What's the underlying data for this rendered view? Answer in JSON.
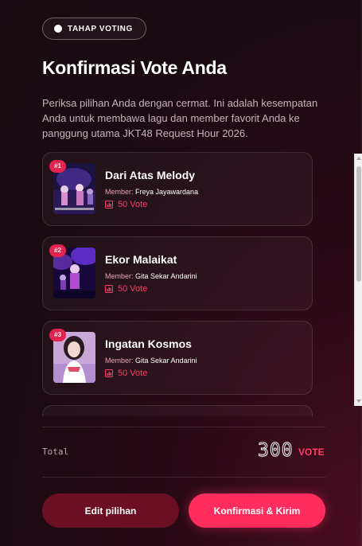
{
  "stage": {
    "label": "TAHAP VOTING"
  },
  "page": {
    "title": "Konfirmasi Vote Anda",
    "description": "Periksa pilihan Anda dengan cermat. Ini adalah kesempatan Anda untuk membawa lagu dan member favorit Anda ke panggung utama JKT48 Request Hour 2026."
  },
  "selections": [
    {
      "rank": "#1",
      "song": "Dari Atas Melody",
      "member_label": "Member:",
      "member": "Freya Jayawardana",
      "votes": "50 Vote",
      "thumb_icon": "stage-performance-photo"
    },
    {
      "rank": "#2",
      "song": "Ekor Malaikat",
      "member_label": "Member:",
      "member": "Gita Sekar Andarini",
      "votes": "50 Vote",
      "thumb_icon": "stage-performance-photo"
    },
    {
      "rank": "#3",
      "song": "Ingatan Kosmos",
      "member_label": "Member:",
      "member": "Gita Sekar Andarini",
      "votes": "50 Vote",
      "thumb_icon": "member-portrait-photo"
    }
  ],
  "total": {
    "label": "Total",
    "value": "300",
    "unit": "VOTE"
  },
  "actions": {
    "edit": "Edit pilihan",
    "confirm": "Konfirmasi & Kirim"
  },
  "colors": {
    "accent": "#ff2d5e",
    "badge": "#e5234f",
    "edit_button": "#6a0f24"
  }
}
